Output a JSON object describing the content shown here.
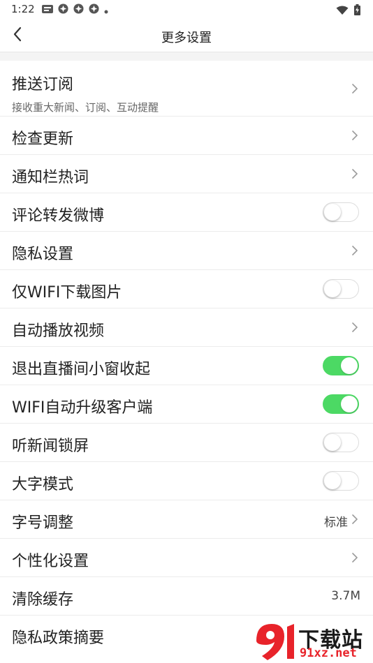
{
  "status_bar": {
    "time": "1:22",
    "icons_left": [
      "news-app-icon",
      "app-badge-icon",
      "app-badge-icon",
      "app-badge-icon",
      "dot-icon"
    ],
    "icons_right": [
      "wifi-icon",
      "battery-charging-icon"
    ]
  },
  "nav": {
    "title": "更多设置"
  },
  "colors": {
    "toggle_on": "#4cd964",
    "divider": "#ececec",
    "watermark_red": "#e8232a"
  },
  "settings": {
    "push": {
      "label": "推送订阅",
      "sub": "接收重大新闻、订阅、互动提醒"
    },
    "check_update": {
      "label": "检查更新"
    },
    "notification_words": {
      "label": "通知栏热词"
    },
    "comment_weibo": {
      "label": "评论转发微博",
      "enabled": false
    },
    "privacy": {
      "label": "隐私设置"
    },
    "wifi_images": {
      "label": "仅WIFI下载图片",
      "enabled": false
    },
    "autoplay": {
      "label": "自动播放视频"
    },
    "live_window": {
      "label": "退出直播间小窗收起",
      "enabled": true
    },
    "wifi_upgrade": {
      "label": "WIFI自动升级客户端",
      "enabled": true
    },
    "lock_screen": {
      "label": "听新闻锁屏",
      "enabled": false
    },
    "big_font": {
      "label": "大字模式",
      "enabled": false
    },
    "font_size": {
      "label": "字号调整",
      "value": "标准"
    },
    "personalize": {
      "label": "个性化设置"
    },
    "clear_cache": {
      "label": "清除缓存",
      "value": "3.7M"
    },
    "privacy_summary": {
      "label": "隐私政策摘要"
    }
  },
  "watermark": {
    "brand": "下载站",
    "url": "91xz.net"
  }
}
